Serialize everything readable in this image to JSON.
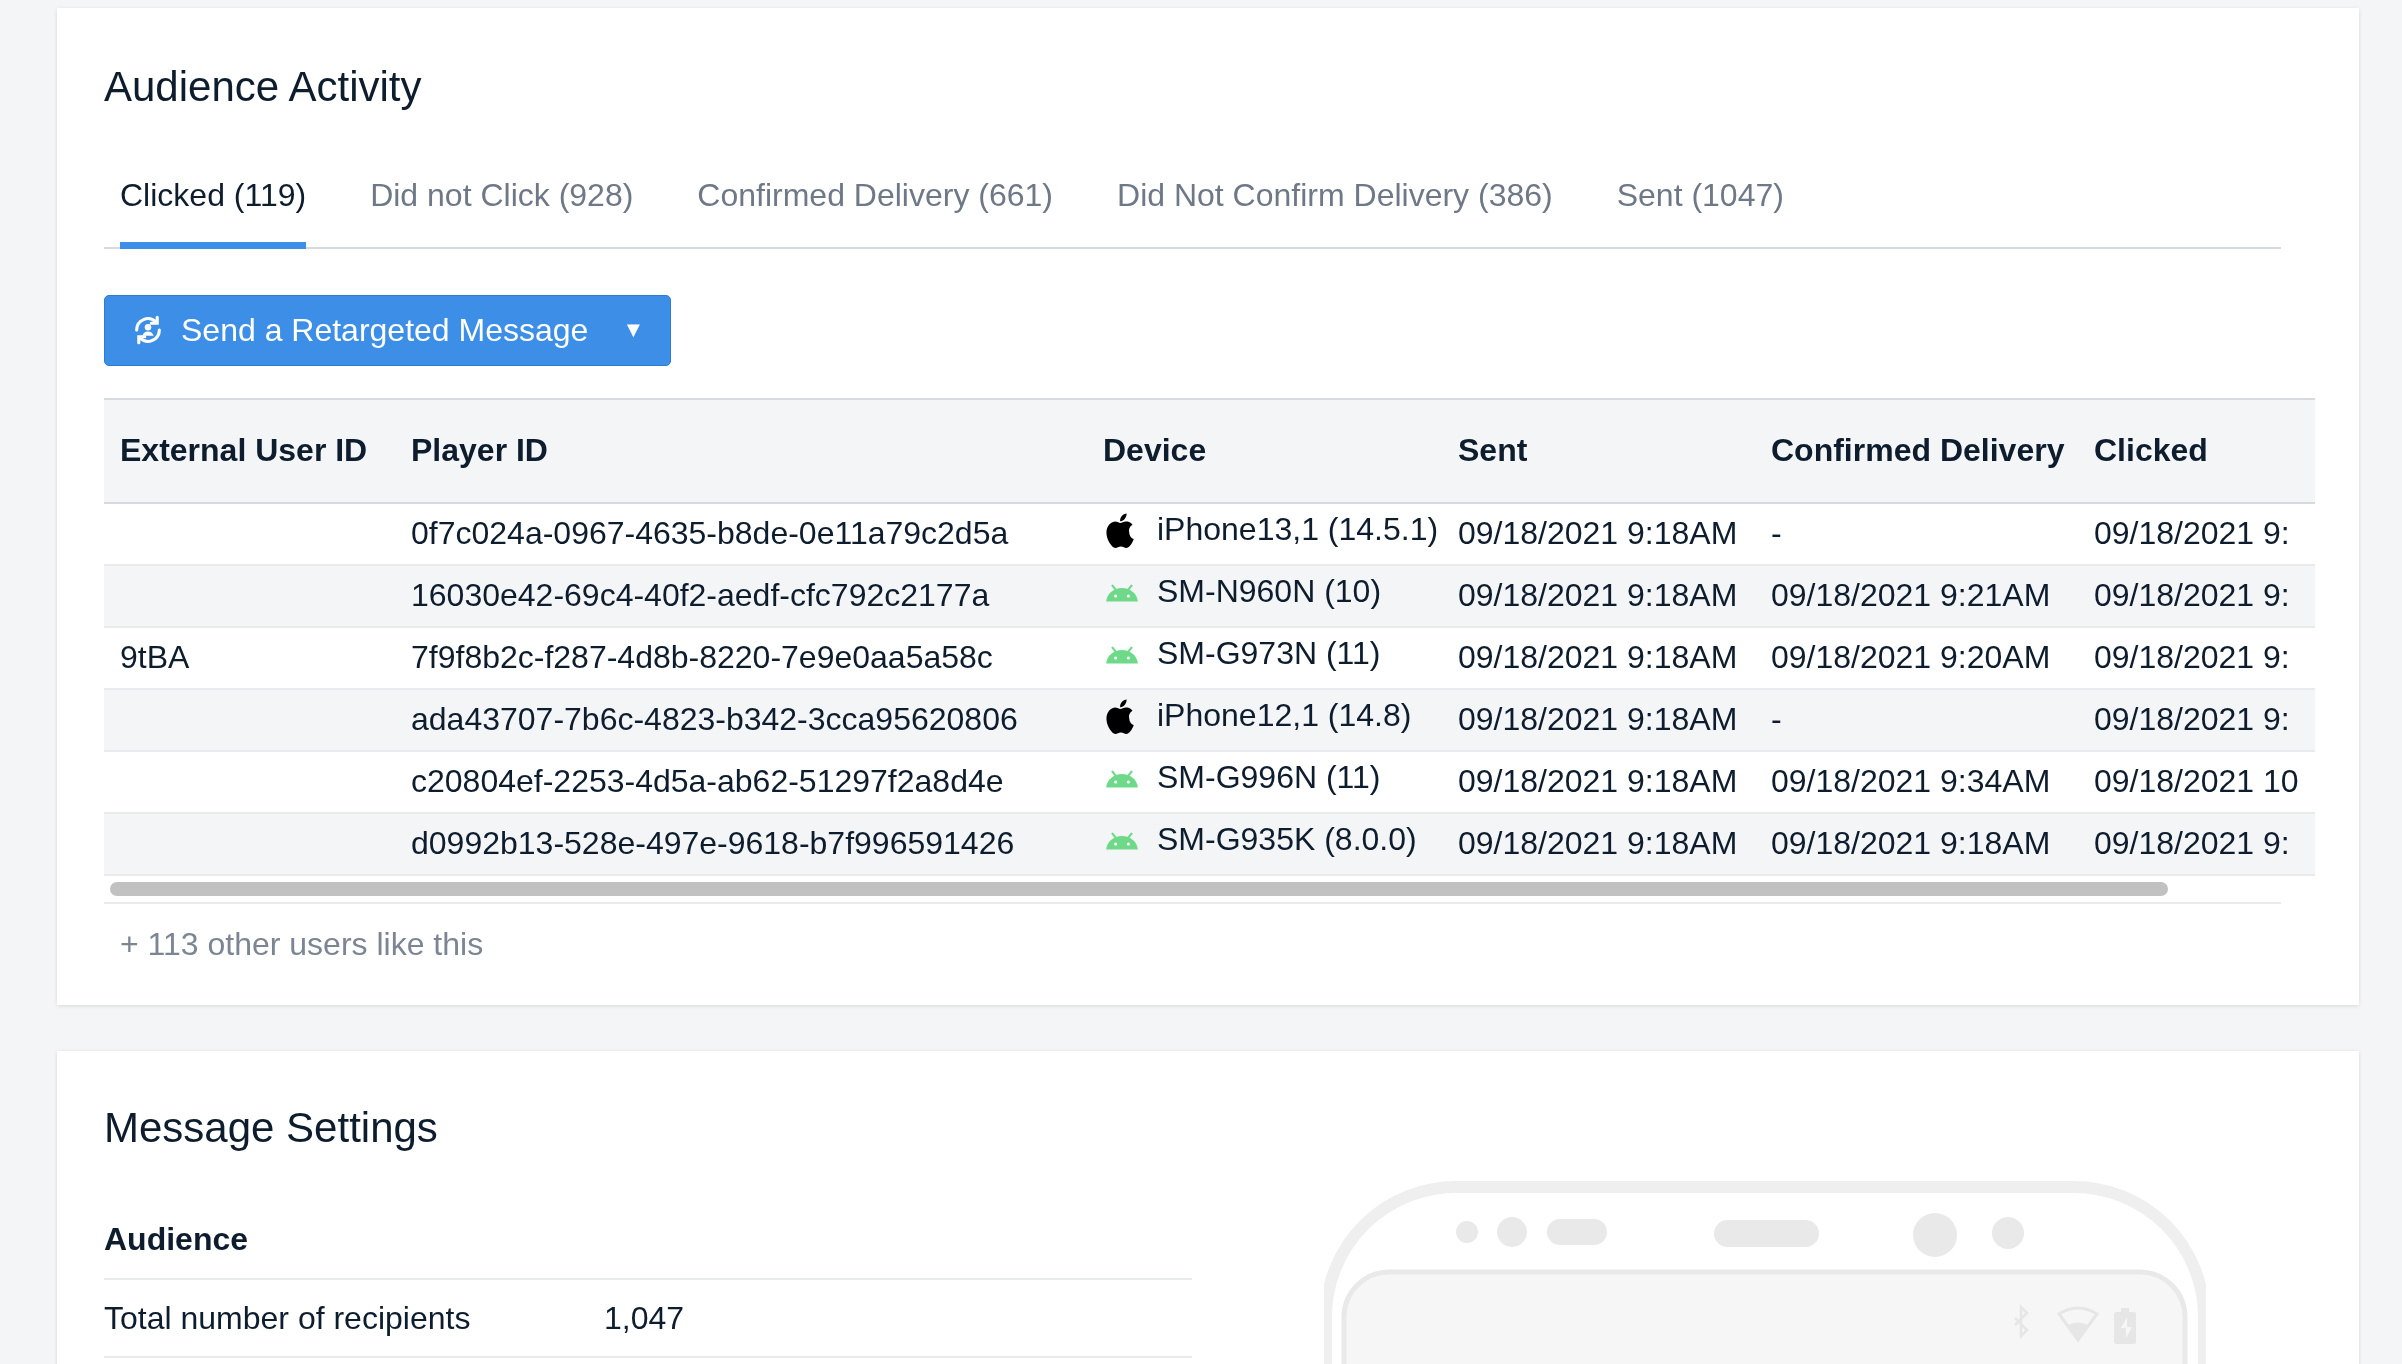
{
  "audience_activity": {
    "title": "Audience Activity",
    "tabs": [
      {
        "label": "Clicked (119)",
        "selected": true
      },
      {
        "label": "Did not Click (928)",
        "selected": false
      },
      {
        "label": "Confirmed Delivery (661)",
        "selected": false
      },
      {
        "label": "Did Not Confirm Delivery (386)",
        "selected": false
      },
      {
        "label": "Sent (1047)",
        "selected": false
      }
    ],
    "retarget_button": {
      "label": "Send a Retargeted Message",
      "caret": "▼"
    },
    "table": {
      "columns": [
        "External User ID",
        "Player ID",
        "Device",
        "Sent",
        "Confirmed Delivery",
        "Clicked"
      ],
      "rows": [
        {
          "external_user_id": "",
          "player_id": "0f7c024a-0967-4635-b8de-0e11a79c2d5a",
          "kind": "ios",
          "device": "iPhone13,1 (14.5.1)",
          "sent": "09/18/2021 9:18AM",
          "confirmed_delivery": "-",
          "clicked": "09/18/2021 9:"
        },
        {
          "external_user_id": "",
          "player_id": "16030e42-69c4-40f2-aedf-cfc792c2177a",
          "kind": "android",
          "device": "SM-N960N (10)",
          "sent": "09/18/2021 9:18AM",
          "confirmed_delivery": "09/18/2021 9:21AM",
          "clicked": "09/18/2021 9:"
        },
        {
          "external_user_id": "9tBA",
          "player_id": "7f9f8b2c-f287-4d8b-8220-7e9e0aa5a58c",
          "kind": "android",
          "device": "SM-G973N (11)",
          "sent": "09/18/2021 9:18AM",
          "confirmed_delivery": "09/18/2021 9:20AM",
          "clicked": "09/18/2021 9:"
        },
        {
          "external_user_id": "",
          "player_id": "ada43707-7b6c-4823-b342-3cca95620806",
          "kind": "ios",
          "device": "iPhone12,1 (14.8)",
          "sent": "09/18/2021 9:18AM",
          "confirmed_delivery": "-",
          "clicked": "09/18/2021 9:"
        },
        {
          "external_user_id": "",
          "player_id": "c20804ef-2253-4d5a-ab62-51297f2a8d4e",
          "kind": "android",
          "device": "SM-G996N (11)",
          "sent": "09/18/2021 9:18AM",
          "confirmed_delivery": "09/18/2021 9:34AM",
          "clicked": "09/18/2021 10"
        },
        {
          "external_user_id": "",
          "player_id": "d0992b13-528e-497e-9618-b7f996591426",
          "kind": "android",
          "device": "SM-G935K (8.0.0)",
          "sent": "09/18/2021 9:18AM",
          "confirmed_delivery": "09/18/2021 9:18AM",
          "clicked": "09/18/2021 9:"
        }
      ]
    },
    "more_users": "+ 113 other users like this"
  },
  "message_settings": {
    "title": "Message Settings",
    "section": "Audience",
    "rows": [
      {
        "label": "Total number of recipients",
        "value": "1,047"
      }
    ]
  }
}
